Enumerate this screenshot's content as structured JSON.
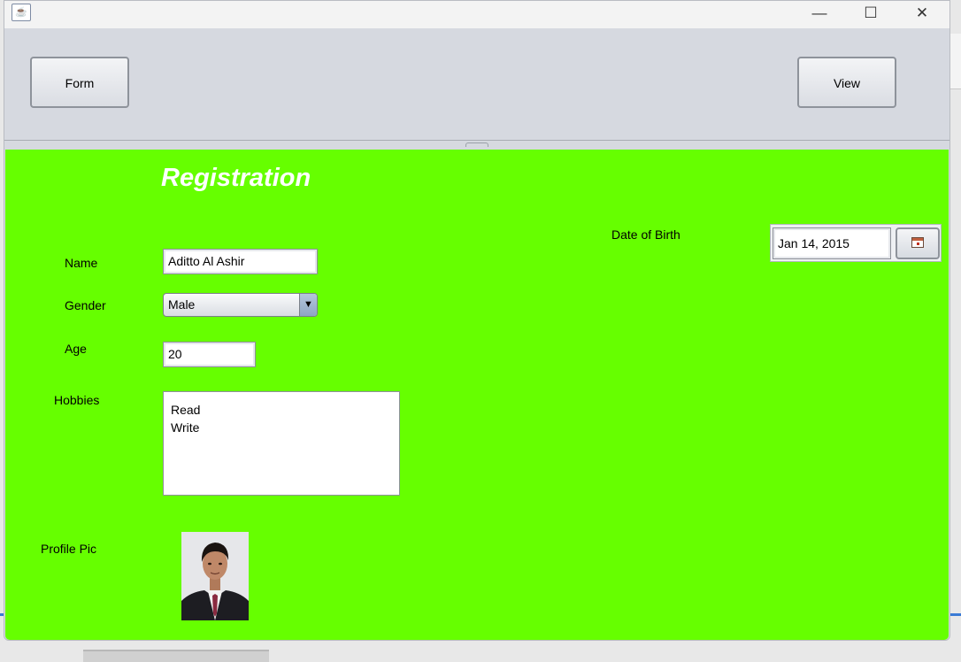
{
  "titlebar": {
    "app_icon": "java-cup-icon",
    "minimize_glyph": "—",
    "maximize_glyph": "☐",
    "close_glyph": "✕"
  },
  "toolbar": {
    "form_label": "Form",
    "view_label": "View"
  },
  "form": {
    "heading": "Registration",
    "name_label": "Name",
    "name_value": "Aditto Al Ashir",
    "gender_label": "Gender",
    "gender_value": "Male",
    "age_label": "Age",
    "age_value": "20",
    "hobbies_label": "Hobbies",
    "hobbies_value": "Read\nWrite",
    "profile_pic_label": "Profile Pic",
    "dob_label": "Date of Birth",
    "dob_value": "Jan 14, 2015"
  },
  "colors": {
    "panel_background": "#66ff00",
    "heading_text": "#ffffff",
    "toolbar_background": "#d6d9e0"
  }
}
